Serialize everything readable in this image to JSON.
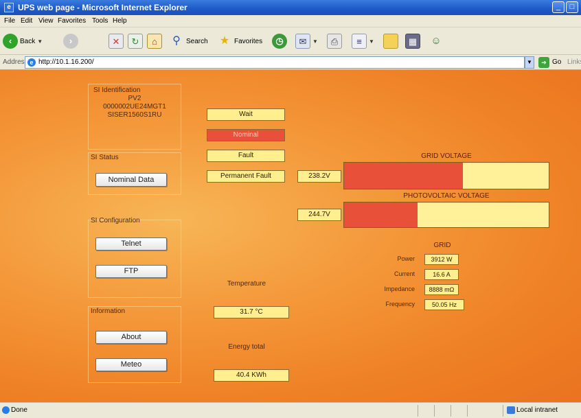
{
  "window": {
    "title": "UPS web page - Microsoft Internet Explorer",
    "min_glyph": "_",
    "max_glyph": "□"
  },
  "menu": [
    "File",
    "Edit",
    "View",
    "Favorites",
    "Tools",
    "Help"
  ],
  "toolbar": {
    "back_label": "Back",
    "search_label": "Search",
    "favorites_label": "Favorites"
  },
  "address": {
    "label": "Address",
    "url": "http://10.1.16.200/",
    "go_label": "Go",
    "links_label": "Links"
  },
  "left_panel": {
    "identification": {
      "title": "SI Identification",
      "lines": [
        "PV2",
        "0000002UE24MGT1",
        "SISER1560S1RU"
      ]
    },
    "status": {
      "title": "SI Status",
      "button": "Nominal Data"
    },
    "configuration": {
      "title": "SI Configuration",
      "buttons": [
        "Telnet",
        "FTP"
      ]
    },
    "information": {
      "title": "Information",
      "buttons": [
        "About",
        "Meteo"
      ]
    }
  },
  "state_indicators": [
    {
      "label": "Wait",
      "active": false
    },
    {
      "label": "Nominal",
      "active": true
    },
    {
      "label": "Fault",
      "active": false
    },
    {
      "label": "Permanent Fault",
      "active": false
    }
  ],
  "voltages": {
    "grid": {
      "title": "GRID VOLTAGE",
      "value": "238.2V",
      "fill_fraction": 0.58
    },
    "pv": {
      "title": "PHOTOVOLTAIC VOLTAGE",
      "value": "244.7V",
      "fill_fraction": 0.36
    }
  },
  "grid": {
    "title": "GRID",
    "rows": [
      {
        "label": "Power",
        "value": "3912 W"
      },
      {
        "label": "Current",
        "value": "16.6 A"
      },
      {
        "label": "Impedance",
        "value": "8888 mΩ"
      },
      {
        "label": "Frequency",
        "value": "50.05 Hz"
      }
    ]
  },
  "temperature": {
    "label": "Temperature",
    "value": "31.7 °C"
  },
  "energy": {
    "label": "Energy total",
    "value": "40.4 KWh"
  },
  "status_bar": {
    "left": "Done",
    "zone": "Local intranet"
  },
  "colors": {
    "page_orange": "#f49a3c",
    "indicator_yellow": "#ffef8e",
    "indicator_red": "#e8503a",
    "xp_blue": "#1f5cc8"
  }
}
